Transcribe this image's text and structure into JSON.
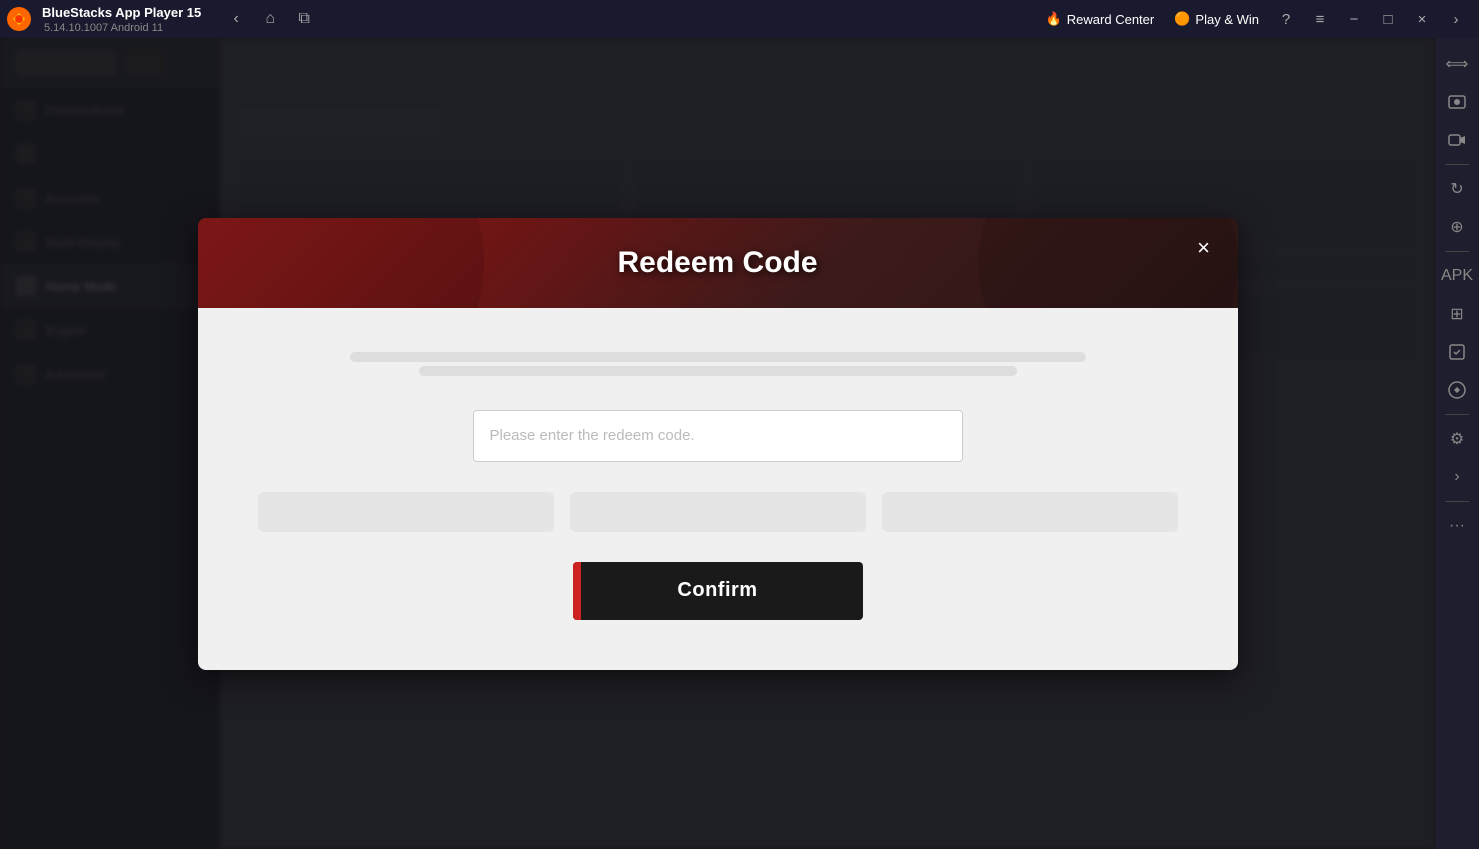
{
  "titleBar": {
    "appName": "BlueStacks App Player 15",
    "version": "5.14.10.1007  Android 11",
    "rewardCenter": "Reward Center",
    "playWin": "Play & Win"
  },
  "modal": {
    "title": "Redeem Code",
    "closeBtn": "×",
    "inputPlaceholder": "Please enter the redeem code.",
    "confirmBtn": "Confirm"
  },
  "sidebar": {
    "items": [
      {
        "label": "Personalizate"
      },
      {
        "label": ""
      },
      {
        "label": "Accounts"
      },
      {
        "label": "Multi-Display"
      },
      {
        "label": "Home Mode"
      },
      {
        "label": "Engine"
      },
      {
        "label": "Advanced"
      }
    ]
  },
  "icons": {
    "back": "‹",
    "home": "⌂",
    "tabs": "⧉",
    "help": "?",
    "menu": "≡",
    "minimize": "−",
    "maximize": "□",
    "close": "×",
    "camera": "📷",
    "screenshot": "⊡",
    "rotate": "↻",
    "zoom": "⊕",
    "settings": "⚙",
    "arrow": "‹",
    "more": "···"
  }
}
